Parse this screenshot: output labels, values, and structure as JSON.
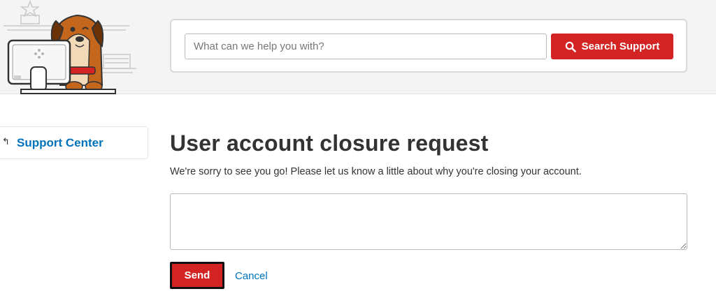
{
  "header": {
    "search": {
      "placeholder": "What can we help you with?",
      "value": "",
      "button_label": "Search Support",
      "button_icon": "search-icon"
    }
  },
  "sidebar": {
    "back_icon": "return-arrow-icon",
    "link_label": "Support Center"
  },
  "main": {
    "title": "User account closure request",
    "description": "We're sorry to see you go! Please let us know a little about why you're closing your account.",
    "reason_value": "",
    "send_label": "Send",
    "cancel_label": "Cancel"
  },
  "colors": {
    "brand_red": "#d32323",
    "link_blue": "#0073bb",
    "header_bg": "#f4f4f4",
    "text": "#333333"
  }
}
